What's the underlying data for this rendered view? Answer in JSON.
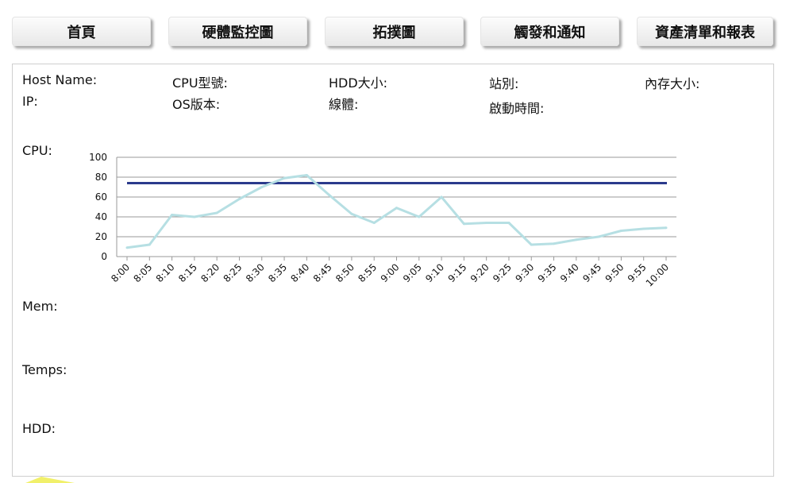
{
  "nav": {
    "items": [
      {
        "label": "首頁"
      },
      {
        "label": "硬體監控圖"
      },
      {
        "label": "拓撲圖"
      },
      {
        "label": "觸發和通知"
      },
      {
        "label": "資產清單和報表"
      }
    ]
  },
  "info": {
    "host_name": "Host Name:",
    "ip": "IP:",
    "cpu_model": "CPU型號:",
    "os_version": "OS版本:",
    "hdd_size": "HDD大小:",
    "line": "線體:",
    "station": "站別:",
    "boot_time": "啟動時間:",
    "memory_size": "內存大小:"
  },
  "sections": {
    "cpu": "CPU:",
    "mem": "Mem:",
    "temps": "Temps:",
    "hdd": "HDD:"
  },
  "colors": {
    "series": "#b6dfe3",
    "threshold": "#2b3a8c",
    "grid": "#9a9a9a"
  },
  "chart_data": {
    "type": "line",
    "title": "",
    "xlabel": "",
    "ylabel": "",
    "categories": [
      "8:00",
      "8:05",
      "8:10",
      "8:15",
      "8:20",
      "8:25",
      "8:30",
      "8:35",
      "8:40",
      "8:45",
      "8:50",
      "8:55",
      "9:00",
      "9:05",
      "9:10",
      "9:15",
      "9:20",
      "9:25",
      "9:30",
      "9:35",
      "9:40",
      "9:45",
      "9:50",
      "9:55",
      "10:00"
    ],
    "series": [
      {
        "values": [
          9,
          12,
          42,
          40,
          44,
          58,
          70,
          79,
          82,
          62,
          43,
          34,
          49,
          40,
          60,
          33,
          34,
          34,
          12,
          13,
          17,
          20,
          26,
          28,
          29
        ]
      }
    ],
    "threshold": 74,
    "ylim": [
      0,
      100
    ],
    "yticks": [
      0,
      20,
      40,
      60,
      80,
      100
    ],
    "grid": true
  }
}
